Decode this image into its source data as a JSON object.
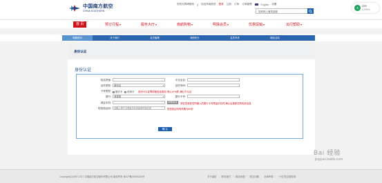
{
  "brand": {
    "name_cn": "中国南方航空",
    "name_en": "CHINA SOUTHERN",
    "color": "#1a3f7a",
    "accent": "#d0121b"
  },
  "topbar": {
    "items": [
      "您的无障碍服务",
      "||",
      "欢迎来南航您",
      "登录",
      "注册",
      "订单",
      "订单管理",
      "English",
      "设置"
    ]
  },
  "search": {
    "placeholder": "如何网上值机选座"
  },
  "badge": {
    "icon": "phone-icon",
    "title": "20%",
    "subtitle": "0.00K/s"
  },
  "nav": {
    "items": [
      {
        "label": "首 页",
        "active": true
      },
      {
        "label": "预订行程",
        "caret": "▾"
      },
      {
        "label": "服务大厅",
        "caret": "▾"
      },
      {
        "label": "南航购物",
        "caret": "▾"
      },
      {
        "label": "明珠会员",
        "caret": "▾"
      },
      {
        "label": "优惠促销",
        "caret": "▾"
      },
      {
        "label": "出行帮助",
        "caret": "▾"
      }
    ]
  },
  "subnav": {
    "tabs": [
      "明珠首页",
      "关于我们",
      "会员管理",
      "我的积分",
      "会员专享",
      "精彩活动"
    ],
    "active_index": 0
  },
  "card": {
    "breadcrumb": "身份认证",
    "section_title": "身份认证",
    "fields": {
      "surname": "姓名拼音:",
      "cn_name": "中文全名:",
      "cert_type": "证件类型:",
      "cert_type_value": "身份证",
      "cert_no": "证件号码:",
      "card_type": "卡号类型:",
      "card_opt1": "借记卡",
      "card_opt2": "信用卡",
      "card_note": "信用卡认证需收取验证费用 请以10%额, 确认卡认证",
      "bank": "银行:",
      "bank_value": "请选择",
      "bank_card": "银行卡号:",
      "phone": "绑定手机:",
      "phone_btn": "获取验证码",
      "phone_note": "请在您收到您所输入的银行卡号预留手机时,确认后更新您的相关信息",
      "sms": "短信验证码:",
      "sms_placeholder": "请输入银行卡预留手机号接收的验证码",
      "sms_note": "短信验证码有效期为60秒",
      "submit": "确 认"
    }
  },
  "footer": {
    "copyright": "Copyright(C)1997-2017 中国南方航空股份有限公司 版权所有  粤ICP备05053330号",
    "links": [
      "关于南航",
      "联系我们",
      "网站地图",
      "常见问题",
      "法律声明",
      "\"十佳\"航空服务商"
    ]
  },
  "watermark": {
    "text": "Bai 经验",
    "sub": "jingyan.baidu.com"
  }
}
